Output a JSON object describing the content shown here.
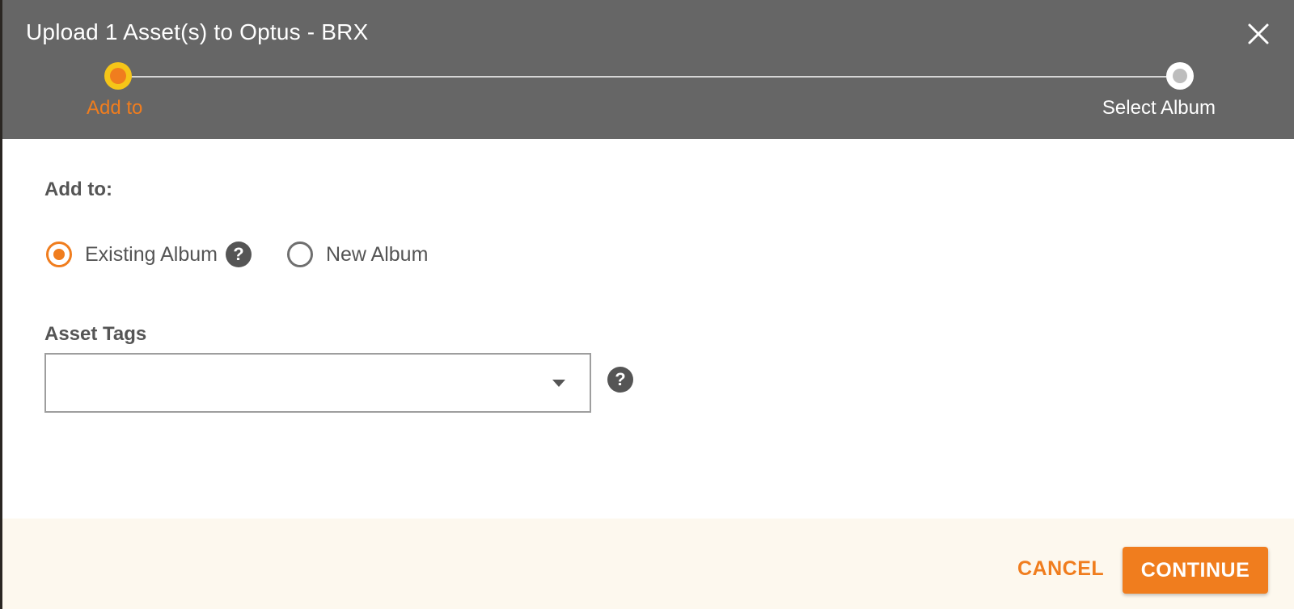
{
  "dialog": {
    "title": "Upload 1 Asset(s) to Optus - BRX",
    "close_icon": "close-icon"
  },
  "stepper": {
    "steps": [
      {
        "label": "Add to",
        "state": "active"
      },
      {
        "label": "Select Album",
        "state": "inactive"
      }
    ]
  },
  "form": {
    "add_to_label": "Add to:",
    "options": [
      {
        "label": "Existing Album",
        "checked": true,
        "help_icon": "question-mark-icon"
      },
      {
        "label": "New Album",
        "checked": false
      }
    ],
    "asset_tags_label": "Asset Tags",
    "asset_tags_value": "",
    "asset_tags_help_icon": "question-mark-icon",
    "dropdown_icon": "caret-down-icon"
  },
  "footer": {
    "cancel_label": "CANCEL",
    "continue_label": "CONTINUE"
  },
  "colors": {
    "accent": "#f07d1e",
    "header_bg": "#666666",
    "footer_bg": "#fdf8ee"
  }
}
